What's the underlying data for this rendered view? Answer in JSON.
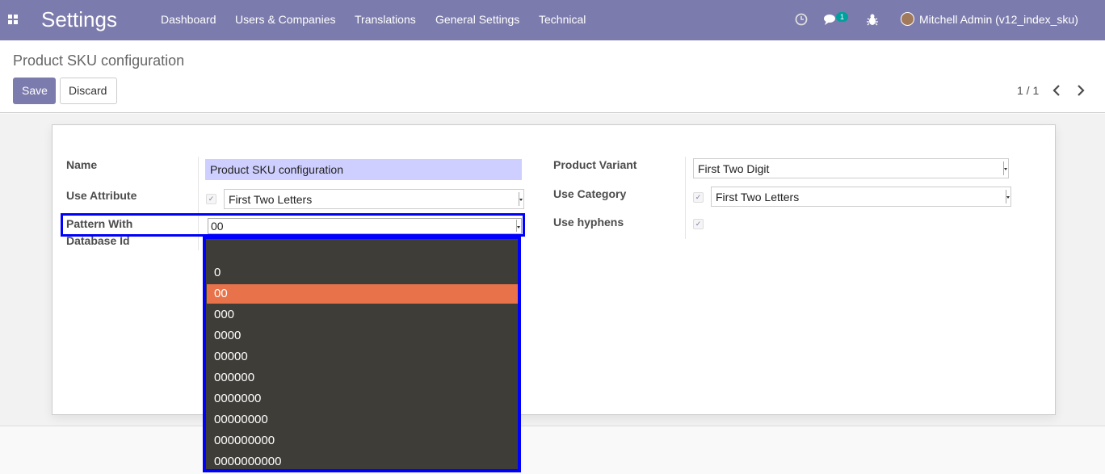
{
  "navbar": {
    "brand": "Settings",
    "menu": [
      "Dashboard",
      "Users & Companies",
      "Translations",
      "General Settings",
      "Technical"
    ],
    "messages_count": "1",
    "user": "Mitchell Admin (v12_index_sku)"
  },
  "control_panel": {
    "breadcrumb": "Product SKU configuration",
    "save_label": "Save",
    "discard_label": "Discard",
    "pager": "1 / 1"
  },
  "form": {
    "name_label": "Name",
    "name_value": "Product SKU configuration",
    "use_attribute_label": "Use Attribute",
    "use_attribute_value": "First Two Letters",
    "pattern_label_line1": "Pattern With",
    "pattern_label_line2": "Database Id",
    "pattern_value": "00",
    "product_variant_label": "Product Variant",
    "product_variant_value": "First Two Digit",
    "use_category_label": "Use Category",
    "use_category_value": "First Two Letters",
    "use_hyphens_label": "Use hyphens"
  },
  "dropdown": {
    "options": [
      "",
      "0",
      "00",
      "000",
      "0000",
      "00000",
      "000000",
      "0000000",
      "00000000",
      "000000000",
      "0000000000"
    ],
    "selected": "00"
  },
  "colors": {
    "navbar": "#7c7bad",
    "highlight": "#0000ff",
    "dropdown_bg": "#3f3d38",
    "dropdown_active": "#e8734a"
  }
}
